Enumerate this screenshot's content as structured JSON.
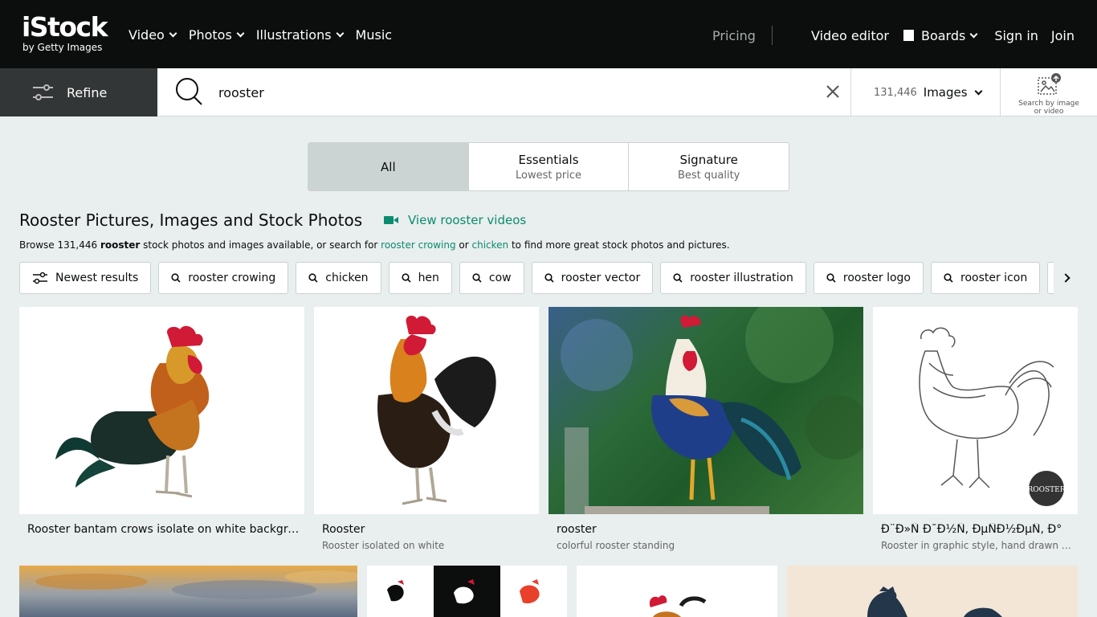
{
  "header": {
    "logo_main": "iStock",
    "logo_sub": "by Getty Images",
    "nav": [
      "Video",
      "Photos",
      "Illustrations",
      "Music"
    ],
    "pricing": "Pricing",
    "video_editor": "Video editor",
    "boards": "Boards",
    "sign_in": "Sign in",
    "join": "Join"
  },
  "search": {
    "refine_label": "Refine",
    "query": "rooster",
    "count": "131,446",
    "type": "Images",
    "search_by_image_line1": "Search by image",
    "search_by_image_line2": "or video"
  },
  "collection_toggle": {
    "all": "All",
    "essentials": "Essentials",
    "essentials_sub": "Lowest price",
    "signature": "Signature",
    "signature_sub": "Best quality",
    "selected": "All"
  },
  "results": {
    "heading": "Rooster Pictures, Images and Stock Photos",
    "video_link": "View rooster videos",
    "browse_prefix": "Browse 131,446 ",
    "browse_term": "rooster",
    "browse_mid": " stock photos and images available, or search for ",
    "browse_link1": "rooster crowing",
    "browse_or": " or ",
    "browse_link2": "chicken",
    "browse_suffix": " to find more great stock photos and pictures."
  },
  "chips": {
    "newest": "Newest results",
    "related": [
      "rooster crowing",
      "chicken",
      "hen",
      "cow",
      "rooster vector",
      "rooster illustration",
      "rooster logo",
      "rooster icon",
      ""
    ]
  },
  "images": [
    {
      "title": "Rooster bantam crows isolate on white backgrou...",
      "subtitle": ""
    },
    {
      "title": "Rooster",
      "subtitle": "Rooster isolated on white"
    },
    {
      "title": "rooster",
      "subtitle": "colorful rooster standing"
    },
    {
      "title": "Ð¨Ð»Ñ Ð¯Ð½Ñ, ÐµÑÐ½ÐµÑ, Ð°",
      "subtitle": "Rooster in graphic style, hand drawn illu...",
      "badge": "ROOSTER"
    }
  ]
}
